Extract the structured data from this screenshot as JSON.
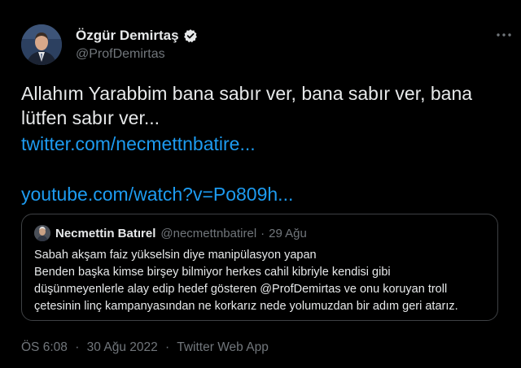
{
  "author": {
    "name": "Özgür Demirtaş",
    "handle": "@ProfDemirtas",
    "verified": true
  },
  "tweet": {
    "text": "Allahım Yarabbim bana sabır ver, bana sabır ver, bana lütfen sabır ver...",
    "links": [
      "twitter.com/necmettnbatire...",
      "youtube.com/watch?v=Po809h..."
    ]
  },
  "quote": {
    "name": "Necmettin Batırel",
    "handle": "@necmettnbatirel",
    "separator": "·",
    "date": "29 Ağu",
    "lines": [
      "Sabah akşam faiz yükselsin diye manipülasyon yapan",
      "Benden başka kimse birşey bilmiyor herkes cahil kibriyle kendisi gibi",
      "düşünmeyenlerle alay edip hedef gösteren  @ProfDemirtas ve onu koruyan troll",
      "çetesinin linç kampanyasından ne korkarız nede yolumuzdan bir adım geri atarız."
    ]
  },
  "meta": {
    "time": "ÖS 6:08",
    "date": "30 Ağu 2022",
    "source": "Twitter Web App",
    "separator": "·"
  },
  "icons": {
    "verified": "verified-badge-icon",
    "more": "more-options-icon"
  },
  "colors": {
    "background": "#000000",
    "text": "#e7e9ea",
    "secondary": "#71767b",
    "link": "#1d9bf0",
    "border": "#3e4144"
  }
}
